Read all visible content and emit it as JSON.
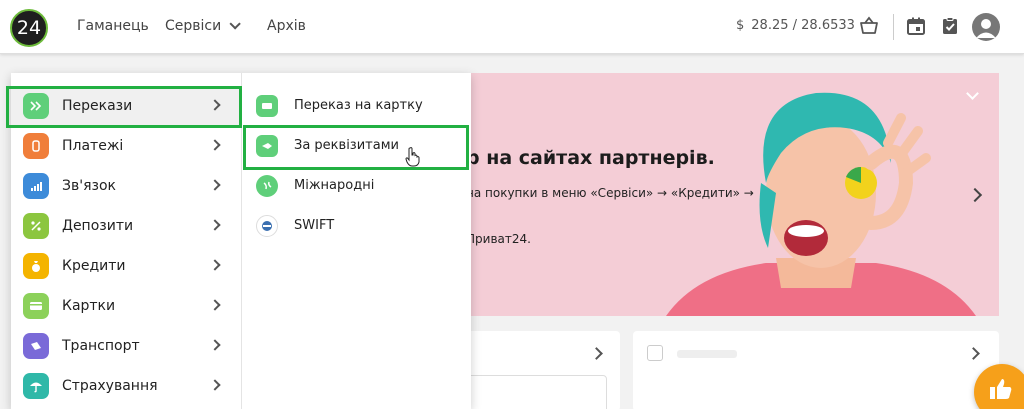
{
  "header": {
    "logo_text": "24",
    "nav": {
      "wallet": "Гаманець",
      "services": "Сервіси",
      "archive": "Архів"
    },
    "rate": {
      "currency_symbol": "$",
      "value": "28.25 / 28.6533"
    },
    "icons": [
      "basket-icon",
      "calendar-icon",
      "task-icon",
      "avatar-icon"
    ]
  },
  "banner": {
    "title": "р на сайтах партнерів.",
    "text_line1": "на покупки в меню «Сервіси» → «Кредити» →",
    "text_line2": "Приват24."
  },
  "menu": {
    "categories": [
      {
        "label": "Перекази",
        "icon": "transfer-icon",
        "color": "#5fcf7a"
      },
      {
        "label": "Платежі",
        "icon": "payments-icon",
        "color": "#f07e3a"
      },
      {
        "label": "Зв'язок",
        "icon": "signal-icon",
        "color": "#3d8bd9"
      },
      {
        "label": "Депозити",
        "icon": "percent-icon",
        "color": "#8cc63f"
      },
      {
        "label": "Кредити",
        "icon": "money-bag-icon",
        "color": "#f4b400"
      },
      {
        "label": "Картки",
        "icon": "card-icon",
        "color": "#8cd15a"
      },
      {
        "label": "Транспорт",
        "icon": "transport-icon",
        "color": "#7a6ad8"
      },
      {
        "label": "Страхування",
        "icon": "umbrella-icon",
        "color": "#2fb8a8"
      }
    ],
    "submenu": [
      {
        "label": "Переказ на картку",
        "icon": "card-transfer-icon",
        "color": "#5fcf7a"
      },
      {
        "label": "За реквізитами",
        "icon": "requisites-icon",
        "color": "#5fcf7a"
      },
      {
        "label": "Міжнародні",
        "icon": "globe-icon",
        "color": "#5fcf7a"
      },
      {
        "label": "SWIFT",
        "icon": "swift-icon",
        "color": "#3a6fb0"
      }
    ]
  },
  "colors": {
    "highlight": "#22b042",
    "banner_bg": "#f4cdd6",
    "like_button": "#f6a01a"
  }
}
